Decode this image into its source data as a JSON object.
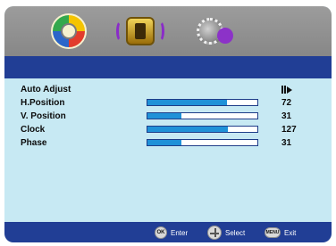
{
  "tabs": [
    {
      "name": "picture-icon"
    },
    {
      "name": "audio-icon"
    },
    {
      "name": "setup-icon"
    }
  ],
  "menu": {
    "items": [
      {
        "label": "Auto Adjust",
        "value": "",
        "level": null,
        "control": "action"
      },
      {
        "label": "H.Position",
        "value": "72",
        "level": 0.72
      },
      {
        "label": "V. Position",
        "value": "31",
        "level": 0.31
      },
      {
        "label": "Clock",
        "value": "127",
        "level": 0.73
      },
      {
        "label": "Phase",
        "value": "31",
        "level": 0.31
      }
    ]
  },
  "footer": {
    "ok_button": "OK",
    "ok_label": "Enter",
    "select_label": "Select",
    "menu_button": "MENU",
    "exit_label": "Exit"
  },
  "colors": {
    "accent": "#213e95",
    "panel": "#c7e9f3",
    "bar_fill": "#1f91d8",
    "topbar": "#878787"
  }
}
